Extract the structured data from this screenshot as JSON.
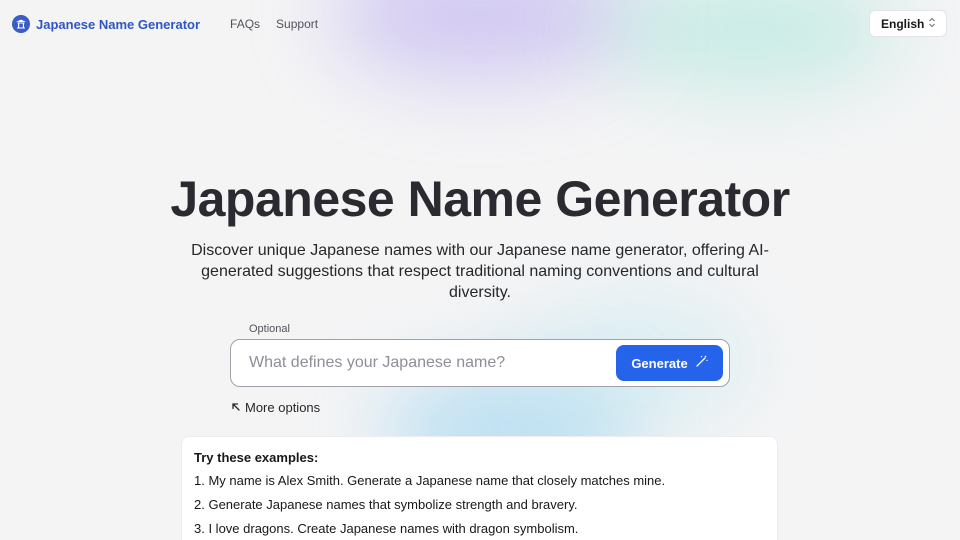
{
  "header": {
    "logo_text": "Japanese Name Generator",
    "nav": [
      {
        "label": "FAQs"
      },
      {
        "label": "Support"
      }
    ],
    "language": "English"
  },
  "hero": {
    "title": "Japanese Name Generator",
    "subtitle": "Discover unique Japanese names with our Japanese name generator, offering AI-generated suggestions that respect traditional naming conventions and cultural diversity."
  },
  "form": {
    "optional_label": "Optional",
    "placeholder": "What defines your Japanese name?",
    "value": "",
    "generate_label": "Generate",
    "more_options_label": "More options"
  },
  "examples": {
    "title": "Try these examples:",
    "items": [
      "1. My name is Alex Smith. Generate a Japanese name that closely matches mine.",
      "2. Generate Japanese names that symbolize strength and bravery.",
      "3. I love dragons. Create Japanese names with dragon symbolism."
    ]
  },
  "colors": {
    "accent": "#2563eb",
    "logo": "#2f56c4",
    "background": "#f4f4f5"
  },
  "icons": {
    "logo": "temple-logo-icon",
    "language_chevron": "chevron-up-down-icon",
    "generate": "magic-wand-icon",
    "more_options": "arrow-up-left-icon"
  }
}
